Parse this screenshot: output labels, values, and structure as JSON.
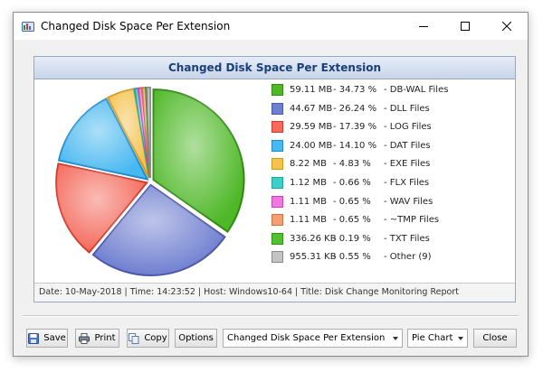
{
  "window": {
    "title": "Changed Disk Space Per Extension",
    "controls": {
      "minimize": "—",
      "maximize": "☐",
      "close": "✕"
    }
  },
  "panel": {
    "title": "Changed Disk Space Per Extension"
  },
  "chart_data": {
    "type": "pie",
    "title": "Changed Disk Space Per Extension",
    "slices": [
      {
        "label": "DB-WAL Files",
        "size": "59.11 MB",
        "percent_text": "- 34.73 %",
        "ext_text": "- DB-WAL Files",
        "value": 34.73,
        "color": "#4fb828",
        "border": "#2e8a10"
      },
      {
        "label": "DLL Files",
        "size": "44.67 MB",
        "percent_text": "- 26.24 %",
        "ext_text": "- DLL Files",
        "value": 26.24,
        "color": "#6f7fd0",
        "border": "#4a57a8"
      },
      {
        "label": "LOG Files",
        "size": "29.59 MB",
        "percent_text": "- 17.39 %",
        "ext_text": "- LOG Files",
        "value": 17.39,
        "color": "#f46a5c",
        "border": "#d03a2c"
      },
      {
        "label": "DAT Files",
        "size": "24.00 MB",
        "percent_text": "- 14.10 %",
        "ext_text": "- DAT Files",
        "value": 14.1,
        "color": "#48b8f0",
        "border": "#1e8ccc"
      },
      {
        "label": "EXE Files",
        "size": "8.22 MB",
        "percent_text": "- 4.83 %",
        "ext_text": "- EXE Files",
        "value": 4.83,
        "color": "#f4c24e",
        "border": "#d09a18"
      },
      {
        "label": "FLX Files",
        "size": "1.12 MB",
        "percent_text": "- 0.66 %",
        "ext_text": "- FLX Files",
        "value": 0.66,
        "color": "#3ed0c8",
        "border": "#1aa49c"
      },
      {
        "label": "WAV Files",
        "size": "1.11 MB",
        "percent_text": "- 0.65 %",
        "ext_text": "- WAV Files",
        "value": 0.65,
        "color": "#f078e0",
        "border": "#c844b4"
      },
      {
        "label": "~TMP Files",
        "size": "1.11 MB",
        "percent_text": "- 0.65 %",
        "ext_text": "- ~TMP Files",
        "value": 0.65,
        "color": "#f4a070",
        "border": "#d0723e"
      },
      {
        "label": "TXT Files",
        "size": "336.26 KB",
        "percent_text": "- 0.19 %",
        "ext_text": "- TXT Files",
        "value": 0.19,
        "color": "#50c030",
        "border": "#2e9414"
      },
      {
        "label": "Other (9)",
        "size": "955.31 KB",
        "percent_text": "- 0.55 %",
        "ext_text": "- Other (9)",
        "value": 0.55,
        "color": "#c4c4c4",
        "border": "#8a8a8a"
      }
    ]
  },
  "status": {
    "text": "Date: 10-May-2018 | Time: 14:23:52 | Host: Windows10-64 | Title: Disk Change Monitoring Report"
  },
  "toolbar": {
    "save_label": "Save",
    "print_label": "Print",
    "copy_label": "Copy",
    "options_label": "Options",
    "report_select_value": "Changed Disk Space Per Extension",
    "chart_type_value": "Pie Chart",
    "close_label": "Close"
  }
}
